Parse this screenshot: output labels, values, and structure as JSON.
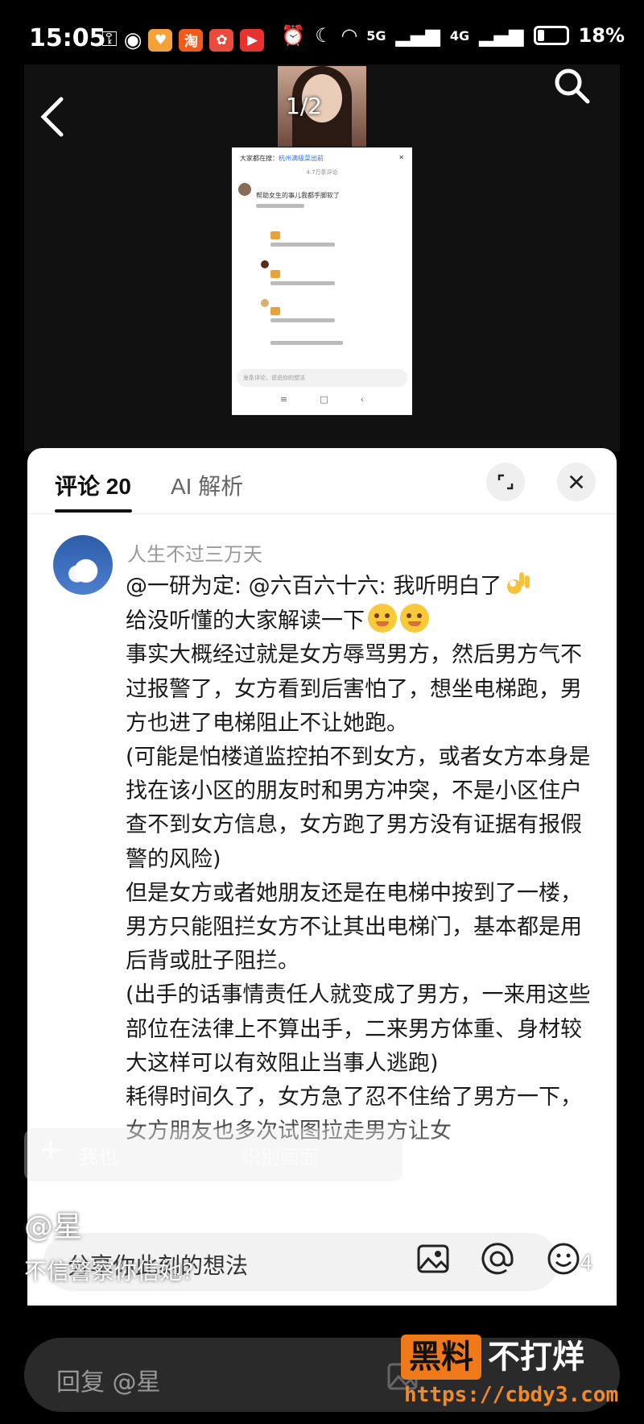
{
  "status_bar": {
    "time": "15:05",
    "battery": "18%",
    "network_1": "5G",
    "network_2": "4G",
    "app_icon_taobao": "淘"
  },
  "video": {
    "page_indicator": "1/2"
  },
  "mini_screenshot": {
    "search_prefix": "大家都在搜：",
    "search_term": "杭州满级菜出前",
    "comment_count": "4.7万条评论",
    "top_comment": "帮助女生的事儿我都手脚软了",
    "input_placeholder": "发条评论，说说你的想法"
  },
  "panel": {
    "tab_comments": "评论 20",
    "tab_ai": "AI 解析",
    "expand_icon": "expand-icon",
    "close_icon": "close-icon"
  },
  "comment": {
    "username": "人生不过三万天",
    "line1": "@一研为定: @六百六十六: 我听明白了",
    "line2": "给没听懂的大家解读一下",
    "paragraph1": "事实大概经过就是女方辱骂男方，然后男方气不过报警了，女方看到后害怕了，想坐电梯跑，男方也进了电梯阻止不让她跑。",
    "paragraph2": "(可能是怕楼道监控拍不到女方，或者女方本身是找在该小区的朋友时和男方冲突，不是小区住户查不到女方信息，女方跑了男方没有证据有报假警的风险)",
    "paragraph3": "但是女方或者她朋友还是在电梯中按到了一楼，男方只能阻拦女方不让其出电梯门，基本都是用后背或肚子阻拦。",
    "paragraph4": "(出手的话事情责任人就变成了男方，一来用这些部位在法律上不算出手，二来男方体重、身材较大这样可以有效阻止当事人逃跑)",
    "paragraph5": "耗得时间久了，女方急了忍不住给了男方一下，女方朋友也多次试图拉走男方让女"
  },
  "overlay": {
    "ghost_left": "我也",
    "ghost_right": "识别画面",
    "author": "@星",
    "caption": "不信警察你信她?",
    "share_placeholder": "分享你此刻的想法",
    "like_count": "4"
  },
  "reply_bar": {
    "placeholder": "回复 @星"
  },
  "watermark": {
    "boxed": "黑料",
    "rest": "不打烊",
    "url": "https://cbdy3.com"
  },
  "colors": {
    "accent_orange": "#f07a1a",
    "panel_bg": "#ffffff",
    "page_bg": "#000000"
  }
}
